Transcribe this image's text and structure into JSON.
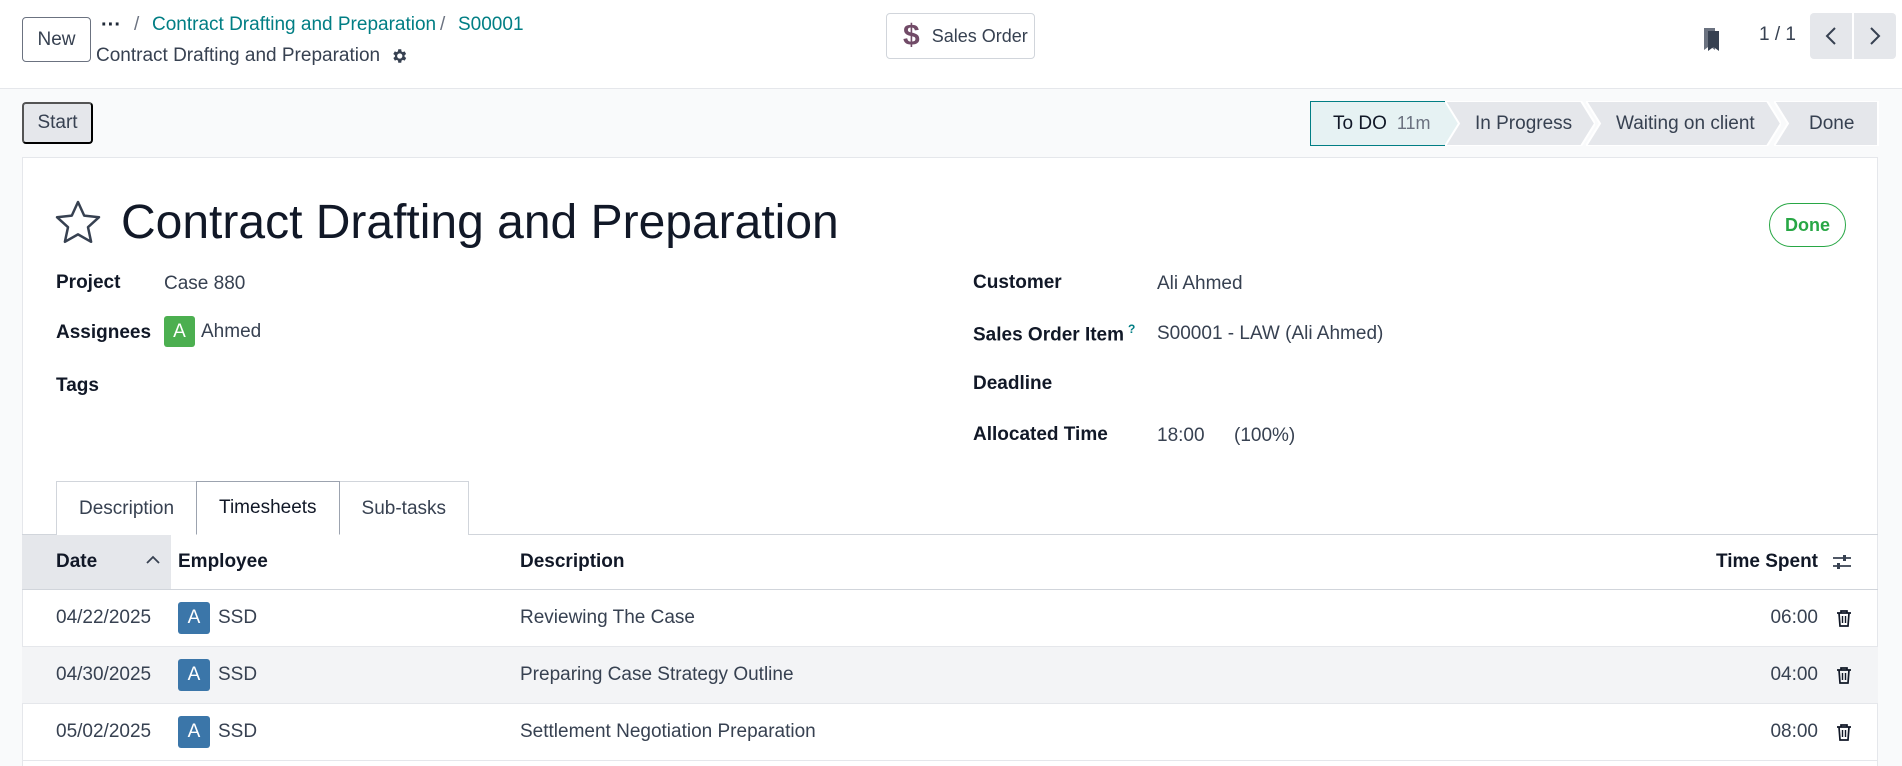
{
  "control_panel": {
    "new_label": "New",
    "breadcrumb": [
      {
        "label": "Contract Drafting and Preparation"
      },
      {
        "label": "S00001"
      }
    ],
    "subtitle": "Contract Drafting and Preparation",
    "sales_order_label": "Sales Order",
    "pager": "1 / 1"
  },
  "statusbar": {
    "start_label": "Start",
    "stages": [
      {
        "label": "To DO",
        "time": "11m",
        "active": true
      },
      {
        "label": "In Progress"
      },
      {
        "label": "Waiting on client"
      },
      {
        "label": "Done"
      }
    ]
  },
  "form": {
    "title": "Contract Drafting and Preparation",
    "state_badge": "Done",
    "left": {
      "project_label": "Project",
      "project_value": "Case 880",
      "assignees_label": "Assignees",
      "assignee_initial": "A",
      "assignee_name": "Ahmed",
      "tags_label": "Tags"
    },
    "right": {
      "customer_label": "Customer",
      "customer_value": "Ali Ahmed",
      "sol_label": "Sales Order Item",
      "sol_help": "?",
      "sol_value": "S00001 - LAW (Ali Ahmed)",
      "deadline_label": "Deadline",
      "allocated_label": "Allocated Time",
      "allocated_value": "18:00",
      "allocated_percent": "(100%)"
    }
  },
  "tabs": [
    {
      "label": "Description"
    },
    {
      "label": "Timesheets",
      "active": true
    },
    {
      "label": "Sub-tasks"
    }
  ],
  "timesheets": {
    "columns": {
      "date": "Date",
      "employee": "Employee",
      "description": "Description",
      "time_spent": "Time Spent"
    },
    "rows": [
      {
        "date": "04/22/2025",
        "emp_initial": "A",
        "employee": "SSD",
        "description": "Reviewing The Case",
        "time_spent": "06:00"
      },
      {
        "date": "04/30/2025",
        "emp_initial": "A",
        "employee": "SSD",
        "description": "Preparing Case Strategy Outline",
        "time_spent": "04:00"
      },
      {
        "date": "05/02/2025",
        "emp_initial": "A",
        "employee": "SSD",
        "description": "Settlement Negotiation Preparation",
        "time_spent": "08:00"
      }
    ]
  },
  "colors": {
    "accent": "#017e84",
    "brand": "#714b67",
    "done": "#28a745"
  }
}
